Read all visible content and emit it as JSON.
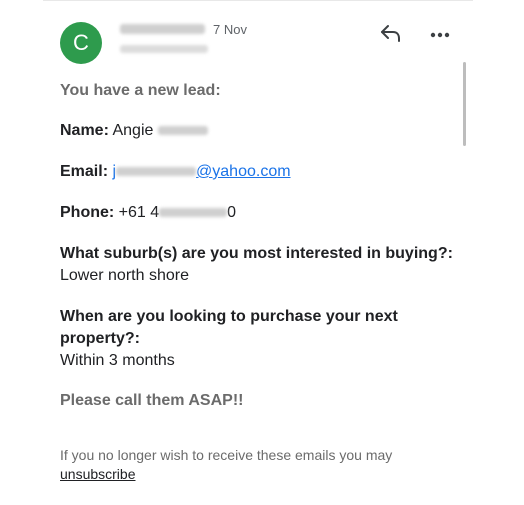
{
  "header": {
    "avatar_letter": "C",
    "date": "7 Nov",
    "reply_icon": "reply-icon",
    "more_icon": "more-vert-icon"
  },
  "message": {
    "intro": "You have a new lead:",
    "name_label": "Name:",
    "name_value": "Angie",
    "email_label": "Email:",
    "email_value_prefix": "j",
    "email_value_suffix": "@yahoo.com",
    "phone_label": "Phone:",
    "phone_value_prefix": "+61 4",
    "phone_value_suffix": "0",
    "q1_label": "What suburb(s) are you most interested in buying?:",
    "q1_value": "Lower north shore",
    "q2_label": "When are you looking to purchase your next property?:",
    "q2_value": "Within 3 months",
    "closing": "Please call them ASAP!!"
  },
  "footer": {
    "text": "If you no longer wish to receive these emails you may",
    "unsubscribe": "unsubscribe"
  },
  "colors": {
    "avatar_bg": "#2e9b4d",
    "link": "#1a73e8",
    "muted_text": "#6b6b6b"
  }
}
